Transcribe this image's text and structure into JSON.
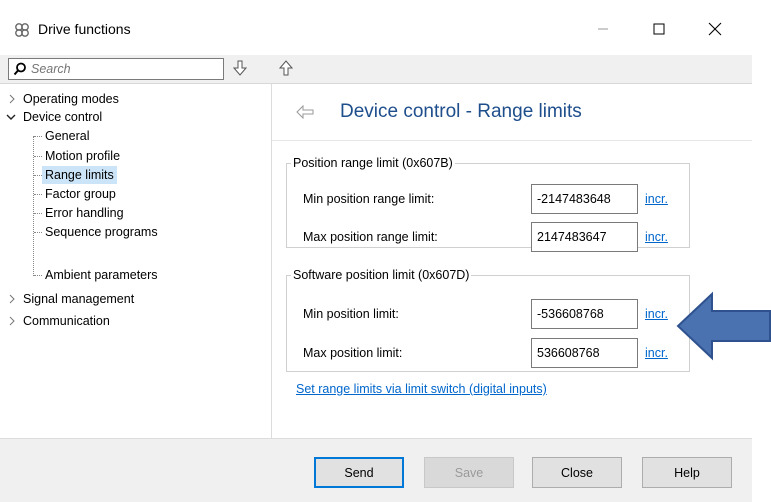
{
  "window": {
    "title": "Drive functions",
    "icon": "gear-cluster-icon",
    "controls": {
      "minimize": "minimize-icon",
      "maximize": "maximize-icon",
      "close": "close-icon"
    }
  },
  "toolbar": {
    "search_placeholder": "Search",
    "search_icon": "search-icon",
    "down_icon": "arrow-down-icon",
    "up_icon": "arrow-up-icon"
  },
  "tree": {
    "items": [
      {
        "label": "Operating modes",
        "expanded": false
      },
      {
        "label": "Device control",
        "expanded": true,
        "children": [
          {
            "label": "General"
          },
          {
            "label": "Motion profile"
          },
          {
            "label": "Range limits",
            "selected": true
          },
          {
            "label": "Factor group"
          },
          {
            "label": "Error handling"
          },
          {
            "label": "Sequence programs"
          },
          {
            "label": "Ambient parameters"
          }
        ]
      },
      {
        "label": "Signal management",
        "expanded": false
      },
      {
        "label": "Communication",
        "expanded": false
      }
    ]
  },
  "content": {
    "title": "Device control - Range limits",
    "back_icon": "back-arrow-icon",
    "position_range_group": {
      "legend": "Position range limit (0x607B)",
      "min_label": "Min position range limit:",
      "min_value": "-2147483648",
      "max_label": "Max position range limit:",
      "max_value": "2147483647",
      "unit": "incr."
    },
    "software_limit_group": {
      "legend": "Software position limit (0x607D)",
      "min_label": "Min position limit:",
      "min_value": "-536608768",
      "max_label": "Max position limit:",
      "max_value": "536608768",
      "unit": "incr."
    },
    "link_text": "Set range limits via limit switch (digital inputs)"
  },
  "footer": {
    "send": "Send",
    "save": "Save",
    "close": "Close",
    "help": "Help"
  },
  "colors": {
    "title_blue": "#1e4e8c",
    "link_blue": "#0066cc",
    "selection": "#cce4f7",
    "annotation_arrow": "#4a72b0"
  }
}
